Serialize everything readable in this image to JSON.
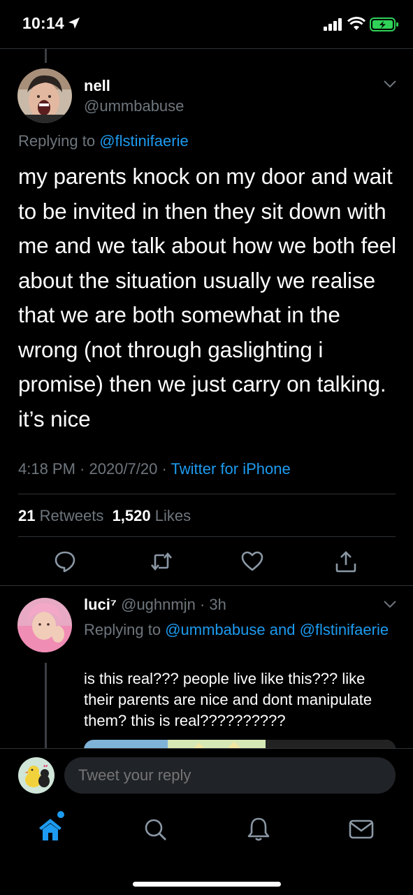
{
  "status_bar": {
    "time": "10:14"
  },
  "tweet": {
    "name": "nell",
    "handle": "@ummbabuse",
    "replying_prefix": "Replying to",
    "replying_to": "@flstinifaerie",
    "text": "my parents knock on my door and wait to be invited in then they sit down with me and we talk about how we both feel about the situation usually we realise that we are both somewhat in the wrong (not through gaslighting i promise) then we just carry on talking. it’s nice",
    "time": "4:18 PM",
    "date": "2020/7/20",
    "source": "Twitter for iPhone",
    "retweets_count": "21",
    "retweets_label": "Retweets",
    "likes_count": "1,520",
    "likes_label": "Likes"
  },
  "reply": {
    "name": "luci⁷",
    "handle": "@ughnmjn",
    "age": "3h",
    "replying_prefix": "Replying to",
    "replying_to_1": "@ummbabuse",
    "replying_and": "and",
    "replying_to_2": "@flstinifaerie",
    "text": "is this real??? people live like this??? like their parents are nice and dont manipulate them? this is real??????????"
  },
  "composer": {
    "placeholder": "Tweet your reply"
  },
  "colors": {
    "accent": "#1d9bf0",
    "muted": "#6e767d",
    "background": "#000000",
    "battery": "#30d158"
  },
  "icons": [
    "location-arrow-icon",
    "signal-icon",
    "wifi-icon",
    "battery-icon",
    "chevron-down-icon",
    "reply-icon",
    "retweet-icon",
    "like-icon",
    "share-icon",
    "home-icon",
    "search-icon",
    "notifications-icon",
    "messages-icon"
  ]
}
